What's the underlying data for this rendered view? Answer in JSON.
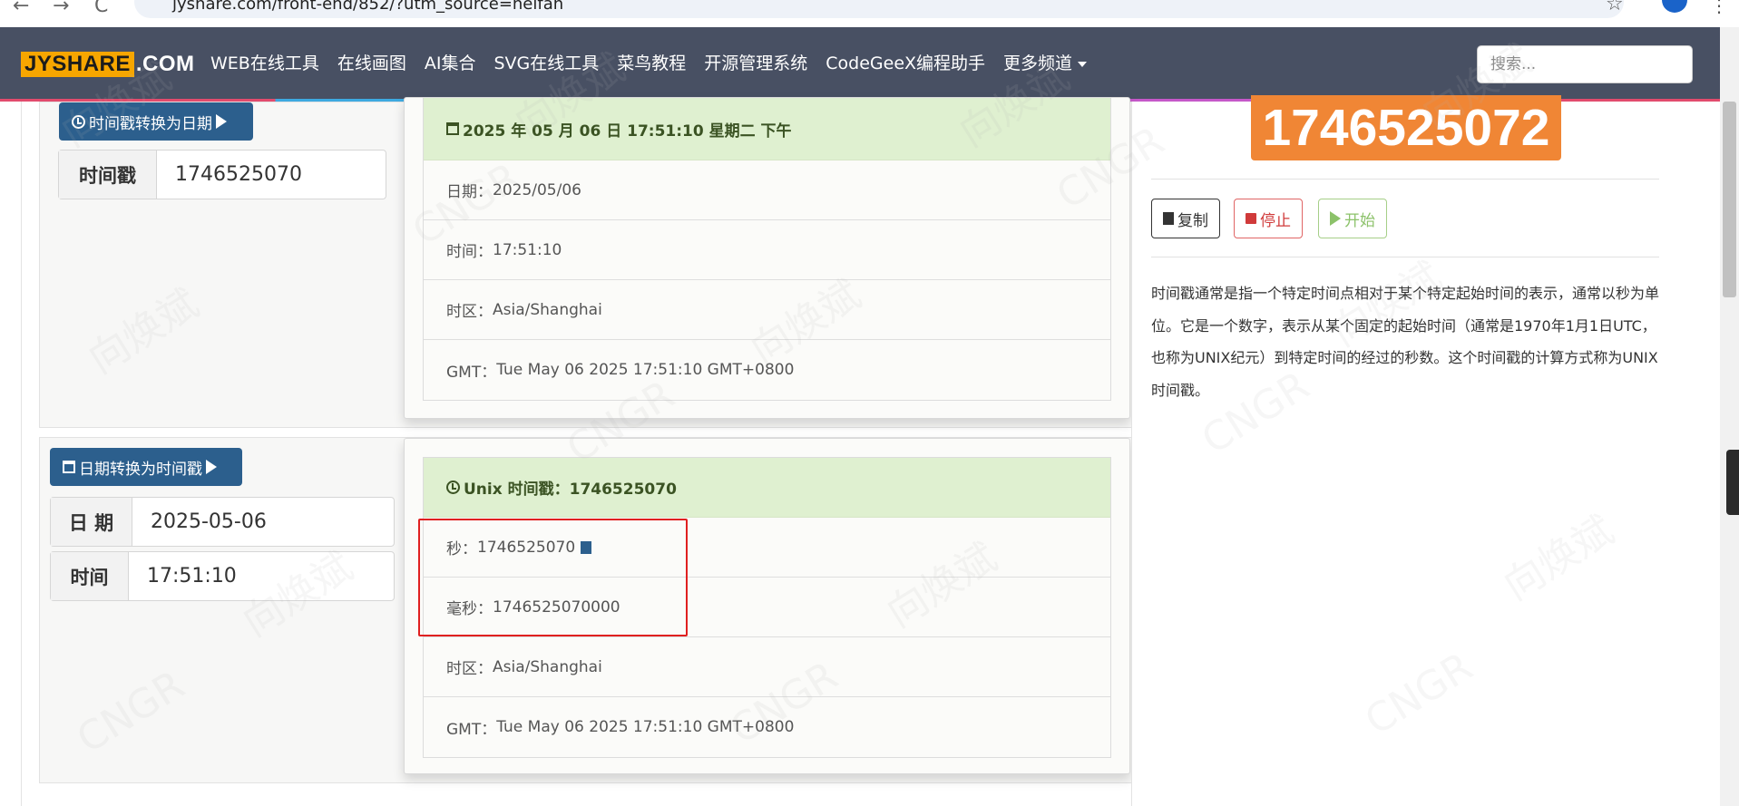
{
  "browser": {
    "url": "jyshare.com/front-end/852/?utm_source=heifan",
    "back_glyph": "←",
    "forward_glyph": "→",
    "reload_glyph": "C",
    "star_glyph": "☆",
    "menu_glyph": "⋮"
  },
  "header": {
    "logo_a": "JYSHARE",
    "logo_b": ".COM",
    "nav": [
      "WEB在线工具",
      "在线画图",
      "AI集合",
      "SVG在线工具",
      "菜鸟教程",
      "开源管理系统",
      "CodeGeeX编程助手",
      "更多频道"
    ],
    "search_placeholder": "搜索..."
  },
  "ts_to_date": {
    "button_label": "时间戳转换为日期",
    "input_label": "时间戳",
    "input_value": "1746525070",
    "result_title": "2025 年 05 月 06 日 17:51:10 星期二 下午",
    "rows": [
      {
        "label": "日期：",
        "value": "2025/05/06"
      },
      {
        "label": "时间：",
        "value": "17:51:10"
      },
      {
        "label": "时区：",
        "value": "Asia/Shanghai"
      },
      {
        "label": "GMT：",
        "value": "Tue May 06 2025 17:51:10 GMT+0800"
      }
    ]
  },
  "date_to_ts": {
    "button_label": "日期转换为时间戳",
    "date_label": "日 期",
    "date_value": "2025-05-06",
    "time_label": "时间",
    "time_value": "17:51:10",
    "result_title": "Unix 时间戳：1746525070",
    "rows": [
      {
        "label": "秒：",
        "value": "1746525070"
      },
      {
        "label": "毫秒：",
        "value": "1746525070000"
      },
      {
        "label": "时区：",
        "value": "Asia/Shanghai"
      },
      {
        "label": "GMT：",
        "value": "Tue May 06 2025 17:51:10 GMT+0800"
      }
    ]
  },
  "current": {
    "timestamp": "1746525072",
    "copy_label": "复制",
    "stop_label": "停止",
    "start_label": "开始",
    "description": "时间戳通常是指一个特定时间点相对于某个特定起始时间的表示，通常以秒为单位。它是一个数字，表示从某个固定的起始时间（通常是1970年1月1日UTC，也称为UNIX纪元）到特定时间的经过的秒数。这个时间戳的计算方式称为UNIX时间戳。"
  },
  "watermarks": [
    "向焕斌",
    "CNGR"
  ],
  "colors": {
    "header_bg": "#485063",
    "primary_button": "#2c5f8d",
    "result_head": "#dff0d0",
    "timestamp_badge": "#f08635",
    "highlight_border": "#e02020"
  }
}
